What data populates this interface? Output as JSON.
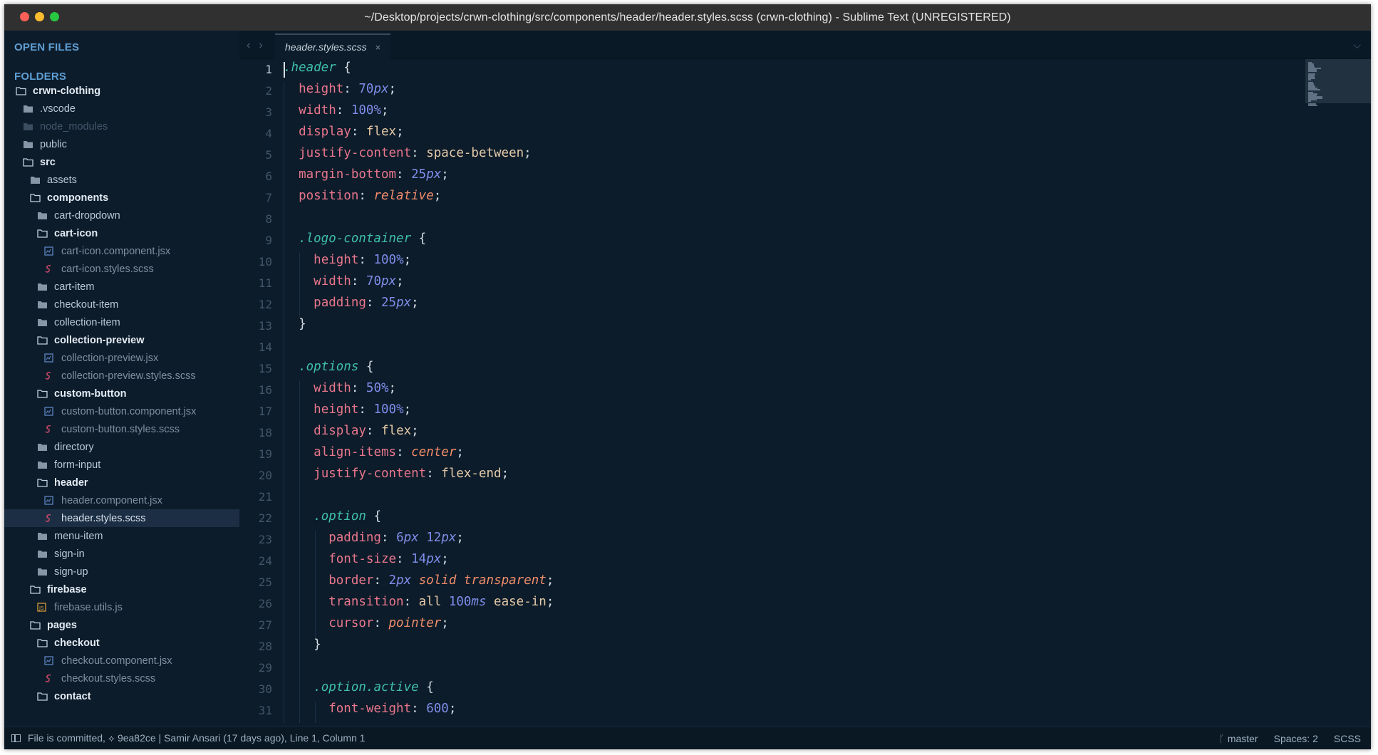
{
  "window": {
    "title": "~/Desktop/projects/crwn-clothing/src/components/header/header.styles.scss (crwn-clothing) - Sublime Text (UNREGISTERED)"
  },
  "sidebar": {
    "open_files_title": "OPEN FILES",
    "folders_title": "FOLDERS",
    "tree": [
      {
        "label": "crwn-clothing",
        "kind": "open-folder",
        "depth": 0
      },
      {
        "label": ".vscode",
        "kind": "closed-folder",
        "depth": 1
      },
      {
        "label": "node_modules",
        "kind": "dim-folder",
        "depth": 1
      },
      {
        "label": "public",
        "kind": "closed-folder",
        "depth": 1
      },
      {
        "label": "src",
        "kind": "open-folder",
        "depth": 1
      },
      {
        "label": "assets",
        "kind": "closed-folder",
        "depth": 2
      },
      {
        "label": "components",
        "kind": "open-folder",
        "depth": 2
      },
      {
        "label": "cart-dropdown",
        "kind": "closed-folder",
        "depth": 3
      },
      {
        "label": "cart-icon",
        "kind": "open-folder",
        "depth": 3
      },
      {
        "label": "cart-icon.component.jsx",
        "kind": "jsx",
        "depth": 4
      },
      {
        "label": "cart-icon.styles.scss",
        "kind": "scss",
        "depth": 4
      },
      {
        "label": "cart-item",
        "kind": "closed-folder",
        "depth": 3
      },
      {
        "label": "checkout-item",
        "kind": "closed-folder",
        "depth": 3
      },
      {
        "label": "collection-item",
        "kind": "closed-folder",
        "depth": 3
      },
      {
        "label": "collection-preview",
        "kind": "open-folder",
        "depth": 3
      },
      {
        "label": "collection-preview.jsx",
        "kind": "jsx",
        "depth": 4
      },
      {
        "label": "collection-preview.styles.scss",
        "kind": "scss",
        "depth": 4
      },
      {
        "label": "custom-button",
        "kind": "open-folder",
        "depth": 3
      },
      {
        "label": "custom-button.component.jsx",
        "kind": "jsx",
        "depth": 4
      },
      {
        "label": "custom-button.styles.scss",
        "kind": "scss",
        "depth": 4
      },
      {
        "label": "directory",
        "kind": "closed-folder",
        "depth": 3
      },
      {
        "label": "form-input",
        "kind": "closed-folder",
        "depth": 3
      },
      {
        "label": "header",
        "kind": "open-folder",
        "depth": 3
      },
      {
        "label": "header.component.jsx",
        "kind": "jsx",
        "depth": 4
      },
      {
        "label": "header.styles.scss",
        "kind": "scss",
        "depth": 4,
        "selected": true
      },
      {
        "label": "menu-item",
        "kind": "closed-folder",
        "depth": 3
      },
      {
        "label": "sign-in",
        "kind": "closed-folder",
        "depth": 3
      },
      {
        "label": "sign-up",
        "kind": "closed-folder",
        "depth": 3
      },
      {
        "label": "firebase",
        "kind": "open-folder",
        "depth": 2
      },
      {
        "label": "firebase.utils.js",
        "kind": "js",
        "depth": 3
      },
      {
        "label": "pages",
        "kind": "open-folder",
        "depth": 2
      },
      {
        "label": "checkout",
        "kind": "open-folder",
        "depth": 3
      },
      {
        "label": "checkout.component.jsx",
        "kind": "jsx",
        "depth": 4
      },
      {
        "label": "checkout.styles.scss",
        "kind": "scss",
        "depth": 4
      },
      {
        "label": "contact",
        "kind": "open-folder",
        "depth": 3
      }
    ]
  },
  "tabs": {
    "active": {
      "label": "header.styles.scss",
      "close_glyph": "×"
    },
    "back_glyph": "‹",
    "forward_glyph": "›",
    "dropdown_glyph": "⌵"
  },
  "editor": {
    "current_line": 1,
    "lines": [
      [
        [
          "sel",
          ".header"
        ],
        [
          "p",
          " {"
        ]
      ],
      [
        [
          "p",
          "  "
        ],
        [
          "prop",
          "height"
        ],
        [
          "p",
          ": "
        ],
        [
          "num",
          "70"
        ],
        [
          "unit",
          "px"
        ],
        [
          "p",
          ";"
        ]
      ],
      [
        [
          "p",
          "  "
        ],
        [
          "prop",
          "width"
        ],
        [
          "p",
          ": "
        ],
        [
          "num",
          "100"
        ],
        [
          "unit",
          "%"
        ],
        [
          "p",
          ";"
        ]
      ],
      [
        [
          "p",
          "  "
        ],
        [
          "prop",
          "display"
        ],
        [
          "p",
          ": "
        ],
        [
          "ident",
          "flex"
        ],
        [
          "p",
          ";"
        ]
      ],
      [
        [
          "p",
          "  "
        ],
        [
          "prop",
          "justify-content"
        ],
        [
          "p",
          ": "
        ],
        [
          "ident",
          "space-between"
        ],
        [
          "p",
          ";"
        ]
      ],
      [
        [
          "p",
          "  "
        ],
        [
          "prop",
          "margin-bottom"
        ],
        [
          "p",
          ": "
        ],
        [
          "num",
          "25"
        ],
        [
          "unit",
          "px"
        ],
        [
          "p",
          ";"
        ]
      ],
      [
        [
          "p",
          "  "
        ],
        [
          "prop",
          "position"
        ],
        [
          "p",
          ": "
        ],
        [
          "kw",
          "relative"
        ],
        [
          "p",
          ";"
        ]
      ],
      [],
      [
        [
          "p",
          "  "
        ],
        [
          "sel",
          ".logo-container"
        ],
        [
          "p",
          " {"
        ]
      ],
      [
        [
          "p",
          "    "
        ],
        [
          "prop",
          "height"
        ],
        [
          "p",
          ": "
        ],
        [
          "num",
          "100"
        ],
        [
          "unit",
          "%"
        ],
        [
          "p",
          ";"
        ]
      ],
      [
        [
          "p",
          "    "
        ],
        [
          "prop",
          "width"
        ],
        [
          "p",
          ": "
        ],
        [
          "num",
          "70"
        ],
        [
          "unit",
          "px"
        ],
        [
          "p",
          ";"
        ]
      ],
      [
        [
          "p",
          "    "
        ],
        [
          "prop",
          "padding"
        ],
        [
          "p",
          ": "
        ],
        [
          "num",
          "25"
        ],
        [
          "unit",
          "px"
        ],
        [
          "p",
          ";"
        ]
      ],
      [
        [
          "p",
          "  }"
        ]
      ],
      [],
      [
        [
          "p",
          "  "
        ],
        [
          "sel",
          ".options"
        ],
        [
          "p",
          " {"
        ]
      ],
      [
        [
          "p",
          "    "
        ],
        [
          "prop",
          "width"
        ],
        [
          "p",
          ": "
        ],
        [
          "num",
          "50"
        ],
        [
          "unit",
          "%"
        ],
        [
          "p",
          ";"
        ]
      ],
      [
        [
          "p",
          "    "
        ],
        [
          "prop",
          "height"
        ],
        [
          "p",
          ": "
        ],
        [
          "num",
          "100"
        ],
        [
          "unit",
          "%"
        ],
        [
          "p",
          ";"
        ]
      ],
      [
        [
          "p",
          "    "
        ],
        [
          "prop",
          "display"
        ],
        [
          "p",
          ": "
        ],
        [
          "ident",
          "flex"
        ],
        [
          "p",
          ";"
        ]
      ],
      [
        [
          "p",
          "    "
        ],
        [
          "prop",
          "align-items"
        ],
        [
          "p",
          ": "
        ],
        [
          "kw",
          "center"
        ],
        [
          "p",
          ";"
        ]
      ],
      [
        [
          "p",
          "    "
        ],
        [
          "prop",
          "justify-content"
        ],
        [
          "p",
          ": "
        ],
        [
          "ident",
          "flex-end"
        ],
        [
          "p",
          ";"
        ]
      ],
      [],
      [
        [
          "p",
          "    "
        ],
        [
          "sel",
          ".option"
        ],
        [
          "p",
          " {"
        ]
      ],
      [
        [
          "p",
          "      "
        ],
        [
          "prop",
          "padding"
        ],
        [
          "p",
          ": "
        ],
        [
          "num",
          "6"
        ],
        [
          "unit",
          "px"
        ],
        [
          "p",
          " "
        ],
        [
          "num",
          "12"
        ],
        [
          "unit",
          "px"
        ],
        [
          "p",
          ";"
        ]
      ],
      [
        [
          "p",
          "      "
        ],
        [
          "prop",
          "font-size"
        ],
        [
          "p",
          ": "
        ],
        [
          "num",
          "14"
        ],
        [
          "unit",
          "px"
        ],
        [
          "p",
          ";"
        ]
      ],
      [
        [
          "p",
          "      "
        ],
        [
          "prop",
          "border"
        ],
        [
          "p",
          ": "
        ],
        [
          "num",
          "2"
        ],
        [
          "unit",
          "px"
        ],
        [
          "p",
          " "
        ],
        [
          "kw",
          "solid"
        ],
        [
          "p",
          " "
        ],
        [
          "kw",
          "transparent"
        ],
        [
          "p",
          ";"
        ]
      ],
      [
        [
          "p",
          "      "
        ],
        [
          "prop",
          "transition"
        ],
        [
          "p",
          ": "
        ],
        [
          "ident",
          "all"
        ],
        [
          "p",
          " "
        ],
        [
          "num",
          "100"
        ],
        [
          "unit",
          "ms"
        ],
        [
          "p",
          " "
        ],
        [
          "ident",
          "ease-in"
        ],
        [
          "p",
          ";"
        ]
      ],
      [
        [
          "p",
          "      "
        ],
        [
          "prop",
          "cursor"
        ],
        [
          "p",
          ": "
        ],
        [
          "kw",
          "pointer"
        ],
        [
          "p",
          ";"
        ]
      ],
      [
        [
          "p",
          "    }"
        ]
      ],
      [],
      [
        [
          "p",
          "    "
        ],
        [
          "sel",
          ".option.active"
        ],
        [
          "p",
          " {"
        ]
      ],
      [
        [
          "p",
          "      "
        ],
        [
          "prop",
          "font-weight"
        ],
        [
          "p",
          ": "
        ],
        [
          "num",
          "600"
        ],
        [
          "p",
          ";"
        ]
      ]
    ]
  },
  "statusbar": {
    "message": "File is committed, ⟡ 9ea82ce | Samir Ansari (17 days ago), Line 1, Column 1",
    "branch": "master",
    "indentation": "Spaces: 2",
    "syntax": "SCSS"
  },
  "colors": {
    "background": "#0c1c2a",
    "selector": "#3fbfab",
    "property": "#e9768c",
    "number": "#7f8dea",
    "keyword": "#f08c6a",
    "sidebar_section": "#5f9fd4"
  }
}
